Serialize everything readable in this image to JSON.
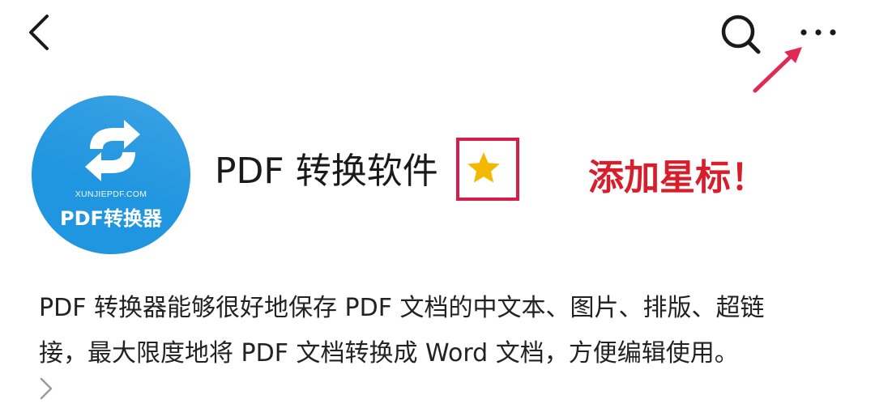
{
  "header": {
    "back_icon": "chevron-left-icon",
    "search_icon": "search-icon",
    "more_icon": "more-horizontal-icon",
    "arrow_icon": "arrow-up-right-icon"
  },
  "app": {
    "avatar": {
      "logo_icon": "refresh-arrows-icon",
      "domain": "XUNJIEPDF.COM",
      "name": "PDF转换器",
      "background_color": "#2196e0"
    },
    "title": "PDF 转换软件",
    "star_icon": "star-icon",
    "star_color": "#f5b800",
    "highlight_color": "#d51e4a"
  },
  "annotation": {
    "text": "添加星标！",
    "color": "#d81e2a"
  },
  "description": {
    "lines": [
      "PDF 转换器能够很好地保存 PDF 文档的中文本、图片、排版、超链",
      "接，最大限度地将 PDF 文档转换成 Word 文档，方便编辑使用。"
    ],
    "expand_icon": "chevron-right-icon"
  }
}
